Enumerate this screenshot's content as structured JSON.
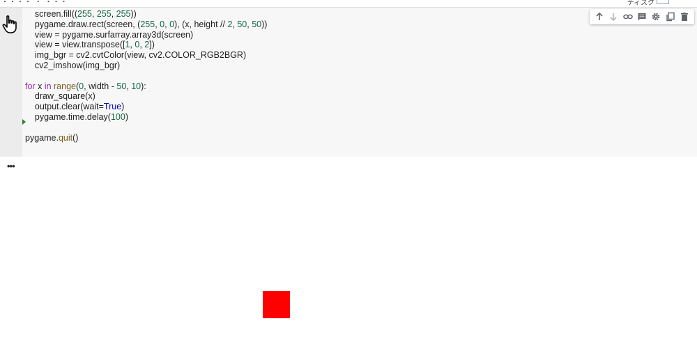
{
  "header": {
    "title_fragment": "・・・・ ・ ・・・",
    "disk_label": "ディスク"
  },
  "code_lines": [
    "    screen.fill((255, 255, 255))",
    "    pygame.draw.rect(screen, (255, 0, 0), (x, height // 2, 50, 50))",
    "    view = pygame.surfarray.array3d(screen)",
    "    view = view.transpose([1, 0, 2])",
    "    img_bgr = cv2.cvtColor(view, cv2.COLOR_RGB2BGR)",
    "    cv2_imshow(img_bgr)",
    "",
    "for x in range(0, width - 50, 10):",
    "    draw_square(x)",
    "    output.clear(wait=True)",
    "    pygame.time.delay(100)",
    "",
    "pygame.quit()"
  ],
  "toolbar": {
    "icons": [
      "arrow-up-icon",
      "arrow-down-icon",
      "link-icon",
      "comment-icon",
      "gear-icon",
      "mirror-cell-icon",
      "trash-icon"
    ]
  },
  "output": {
    "ellipsis": "•••",
    "square_color": "#ff0000"
  },
  "colors": {
    "cell_bg": "#f7f7f7",
    "gutter_bg": "#ececec",
    "keyword": "#9c27b0",
    "number": "#116644"
  }
}
